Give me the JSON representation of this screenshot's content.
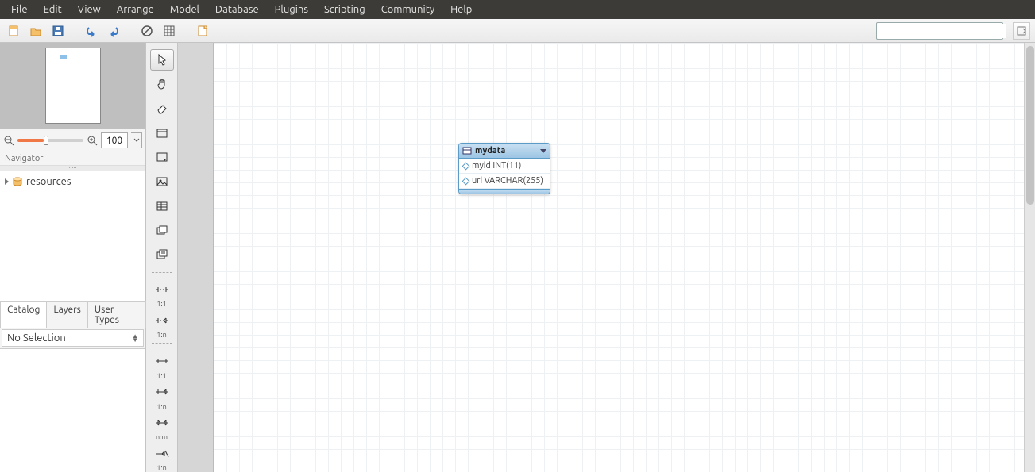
{
  "menu": [
    "File",
    "Edit",
    "View",
    "Arrange",
    "Model",
    "Database",
    "Plugins",
    "Scripting",
    "Community",
    "Help"
  ],
  "toolbar_icons": [
    "new-file-icon",
    "open-folder-icon",
    "save-icon",
    "undo-icon",
    "redo-icon",
    "eraser-icon",
    "grid-icon",
    "new-tab-icon"
  ],
  "search_placeholder": "",
  "navigator": {
    "label": "Navigator",
    "zoom": "100"
  },
  "catalog": {
    "items": [
      {
        "label": "resources"
      }
    ]
  },
  "tabs": [
    "Catalog",
    "Layers",
    "User Types"
  ],
  "selection": "No Selection",
  "palette_tools": [
    {
      "name": "pointer-icon",
      "selected": true
    },
    {
      "name": "hand-icon"
    },
    {
      "name": "eraser-icon"
    },
    {
      "name": "layer-icon"
    },
    {
      "name": "note-icon"
    },
    {
      "name": "image-icon"
    },
    {
      "name": "table-icon"
    },
    {
      "name": "view-icon"
    },
    {
      "name": "routine-group-icon"
    }
  ],
  "palette_relations": [
    "1:1",
    "1:n",
    "1:1",
    "1:n",
    "n:m",
    "1:n"
  ],
  "entity": {
    "name": "mydata",
    "columns": [
      {
        "text": "myid INT(11)"
      },
      {
        "text": "uri VARCHAR(255)"
      }
    ]
  }
}
